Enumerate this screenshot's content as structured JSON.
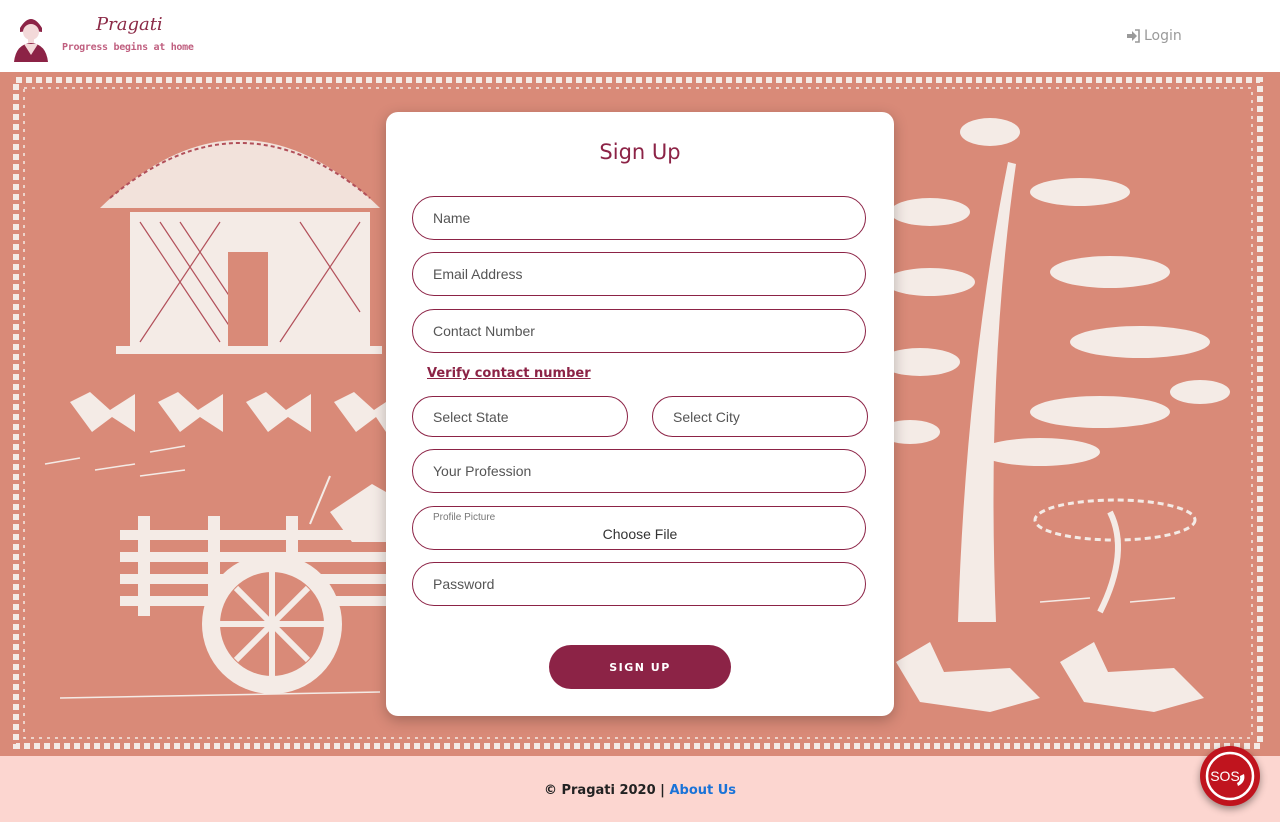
{
  "header": {
    "brand_name": "Pragati",
    "tagline": "Progress begins at home",
    "login_label": "Login"
  },
  "form": {
    "title": "Sign Up",
    "name_placeholder": "Name",
    "email_placeholder": "Email Address",
    "contact_placeholder": "Contact Number",
    "verify_link": "Verify contact number",
    "state_placeholder": "Select State",
    "city_placeholder": "Select City",
    "profession_placeholder": "Your Profession",
    "profile_picture_label": "Profile Picture",
    "choose_file_label": "Choose File",
    "password_placeholder": "Password",
    "submit_label": "SIGN UP"
  },
  "footer": {
    "copyright": "© Pragati 2020 |",
    "about_link": "About Us"
  },
  "sos": {
    "label": "SOS"
  },
  "colors": {
    "brand": "#8c2346",
    "hero_background": "#d98a78",
    "footer_background": "#fcd6d0",
    "link_blue": "#1a73d8",
    "sos_red": "#c0141e"
  }
}
